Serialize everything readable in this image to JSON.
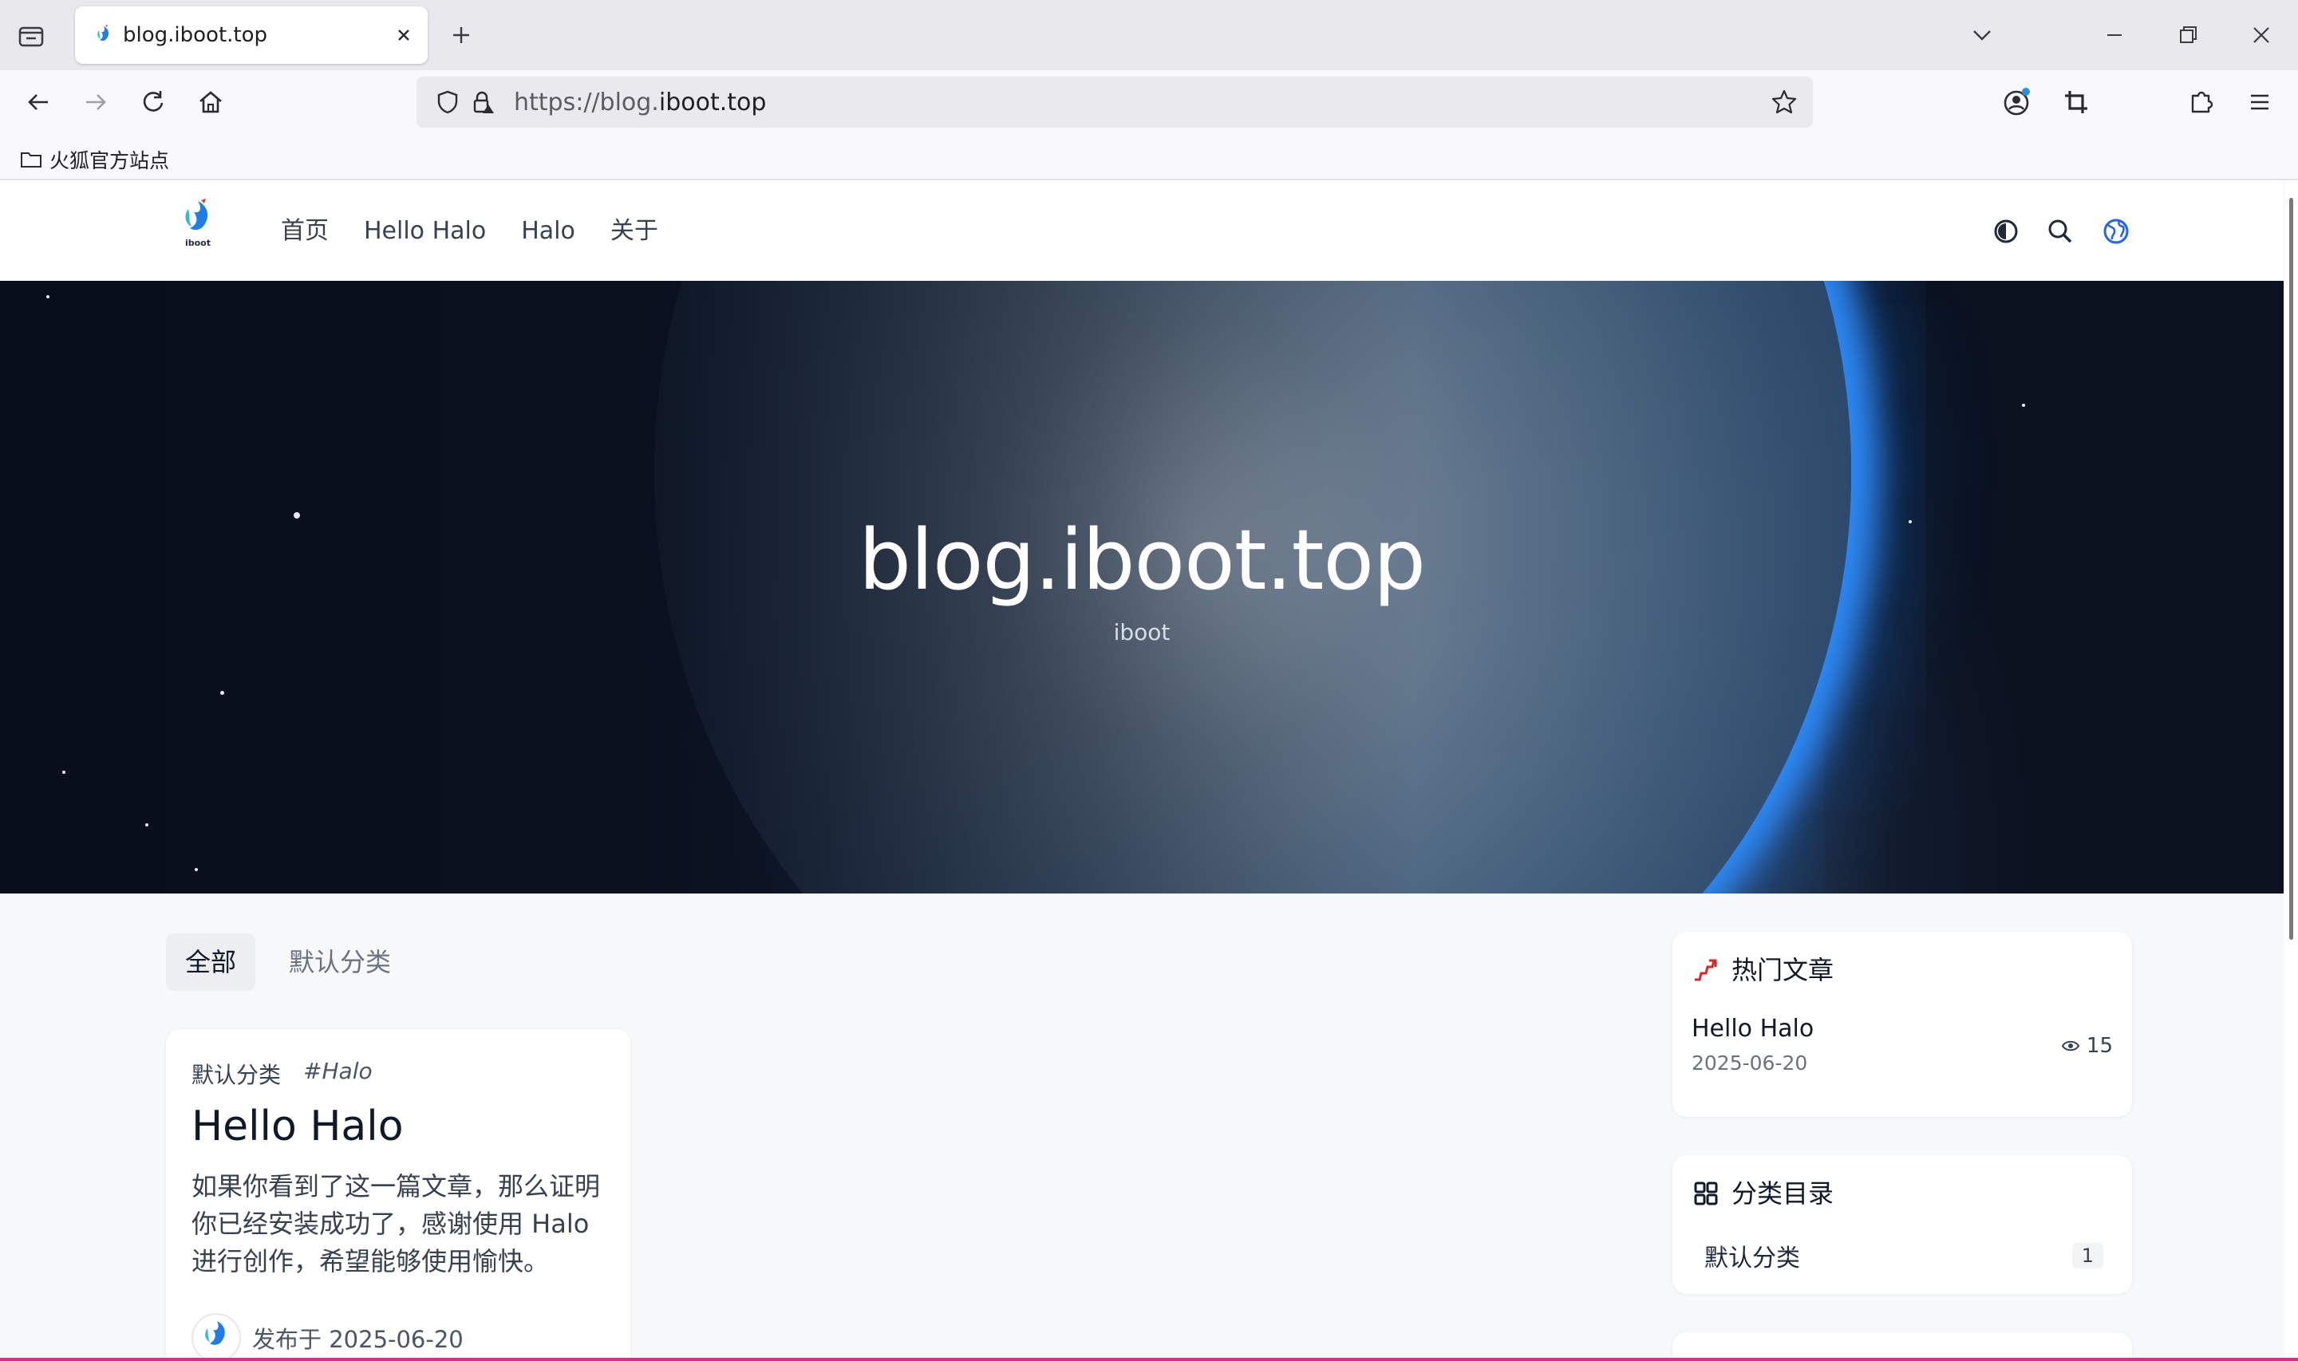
{
  "browser": {
    "tab": {
      "title": "blog.iboot.top"
    },
    "url": {
      "prefix": "https://blog.",
      "domain": "iboot.top"
    },
    "bookmarks": [
      {
        "label": "火狐官方站点"
      }
    ]
  },
  "site": {
    "logo_text": "iboot",
    "nav": [
      "首页",
      "Hello Halo",
      "Halo",
      "关于"
    ],
    "hero": {
      "title": "blog.iboot.top",
      "subtitle": "iboot"
    },
    "category_tabs": [
      "全部",
      "默认分类"
    ],
    "post": {
      "category": "默认分类",
      "tag": "#Halo",
      "title": "Hello Halo",
      "excerpt": "如果你看到了这一篇文章，那么证明你已经安装成功了，感谢使用 Halo 进行创作，希望能够使用愉快。",
      "date": "发布于 2025-06-20"
    },
    "hot_widget": {
      "title": "热门文章",
      "items": [
        {
          "title": "Hello Halo",
          "date": "2025-06-20",
          "views": "15"
        }
      ]
    },
    "category_widget": {
      "title": "分类目录",
      "items": [
        {
          "name": "默认分类",
          "count": "1"
        }
      ]
    }
  },
  "colors": {
    "accent_red": "#dc2626",
    "link_blue": "#2563eb",
    "hero_glow": "#2f8fff"
  }
}
